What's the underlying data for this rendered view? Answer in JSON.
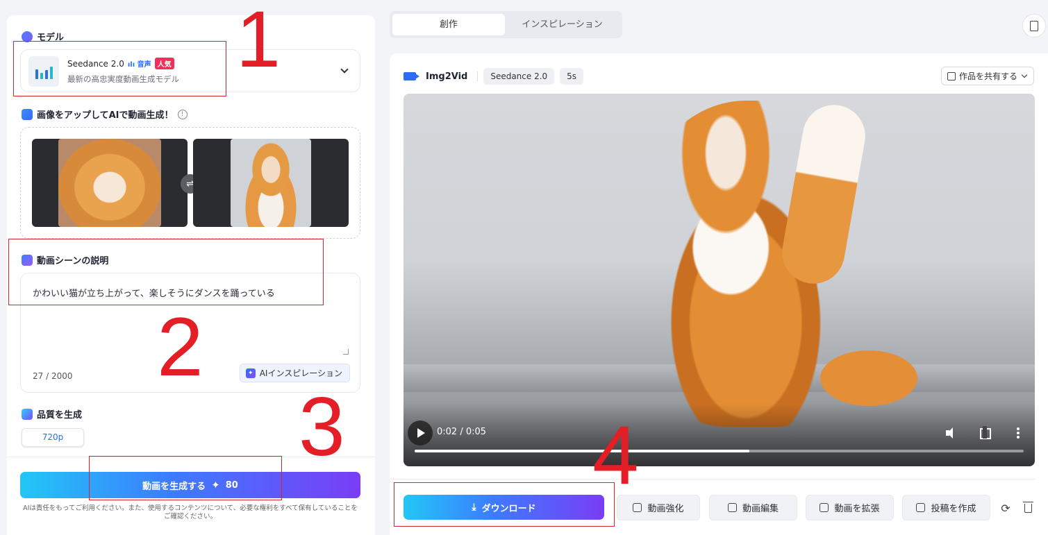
{
  "left": {
    "model": {
      "section_title": "モデル",
      "name": "Seedance 2.0",
      "audio_tag": "音声",
      "hot_tag": "人気",
      "subtitle": "最新の高忠実度動画生成モデル"
    },
    "upload": {
      "section_title": "画像をアップしてAIで動画生成！",
      "info_glyph": "!",
      "swap_glyph": "⇌"
    },
    "description": {
      "section_title": "動画シーンの説明",
      "text": "かわいい猫が立ち上がって、楽しそうにダンスを踊っている",
      "counter": "27 / 2000",
      "ai_button": "AIインスピレーション",
      "ai_icon_glyph": "✦"
    },
    "quality": {
      "section_title": "品質を生成",
      "selected": "720p"
    },
    "generate": {
      "label": "動画を生成する",
      "spark_glyph": "✦",
      "cost": "80",
      "disclaimer": "AIは責任をもってご利用ください。また、使用するコンテンツについて、必要な権利をすべて保有していることをご確認ください。"
    }
  },
  "tabs": [
    {
      "label": "創作",
      "active": true
    },
    {
      "label": "インスピレーション",
      "active": false
    }
  ],
  "right": {
    "mode_title": "Img2Vid",
    "model_pill": "Seedance 2.0",
    "duration_pill": "5s",
    "share_label": "作品を共有する",
    "player": {
      "time": "0:02 / 0:05",
      "progress": 0.55
    },
    "download_label": "ダウンロード",
    "download_glyph": "⤓",
    "actions": [
      "動画強化",
      "動画編集",
      "動画を拡張",
      "投稿を作成"
    ],
    "refresh_glyph": "⟳"
  },
  "annotations": [
    "1",
    "2",
    "3",
    "4"
  ],
  "colors": {
    "annotation_red": "#e41e26",
    "accent_blue": "#2d6cf5",
    "hot_tag": "#f0305a"
  }
}
